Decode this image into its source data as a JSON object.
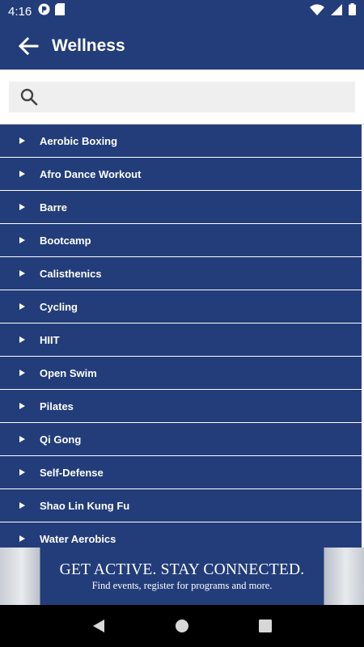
{
  "status_bar": {
    "time": "4:16",
    "icons": [
      "app-notification-icon",
      "sd-card-icon",
      "wifi-icon",
      "signal-icon",
      "battery-icon"
    ]
  },
  "app_bar": {
    "title": "Wellness",
    "back_icon": "back-arrow-icon"
  },
  "search": {
    "placeholder": "",
    "value": "",
    "icon": "search-icon"
  },
  "list": {
    "items": [
      {
        "label": "Aerobic Boxing"
      },
      {
        "label": "Afro Dance Workout"
      },
      {
        "label": "Barre"
      },
      {
        "label": "Bootcamp"
      },
      {
        "label": "Calisthenics"
      },
      {
        "label": "Cycling"
      },
      {
        "label": "HIIT"
      },
      {
        "label": "Open Swim"
      },
      {
        "label": "Pilates"
      },
      {
        "label": "Qi Gong"
      },
      {
        "label": "Self-Defense"
      },
      {
        "label": "Shao Lin Kung Fu"
      },
      {
        "label": "Water Aerobics"
      }
    ]
  },
  "banner": {
    "title": "GET ACTIVE.  STAY CONNECTED.",
    "subtitle": "Find events, register for programs and more."
  },
  "nav_bar": {
    "buttons": [
      "back-triangle-icon",
      "home-circle-icon",
      "recents-square-icon"
    ]
  },
  "colors": {
    "primary": "#233d7a",
    "search_bg": "#efefef",
    "nav_bg": "#000000"
  }
}
